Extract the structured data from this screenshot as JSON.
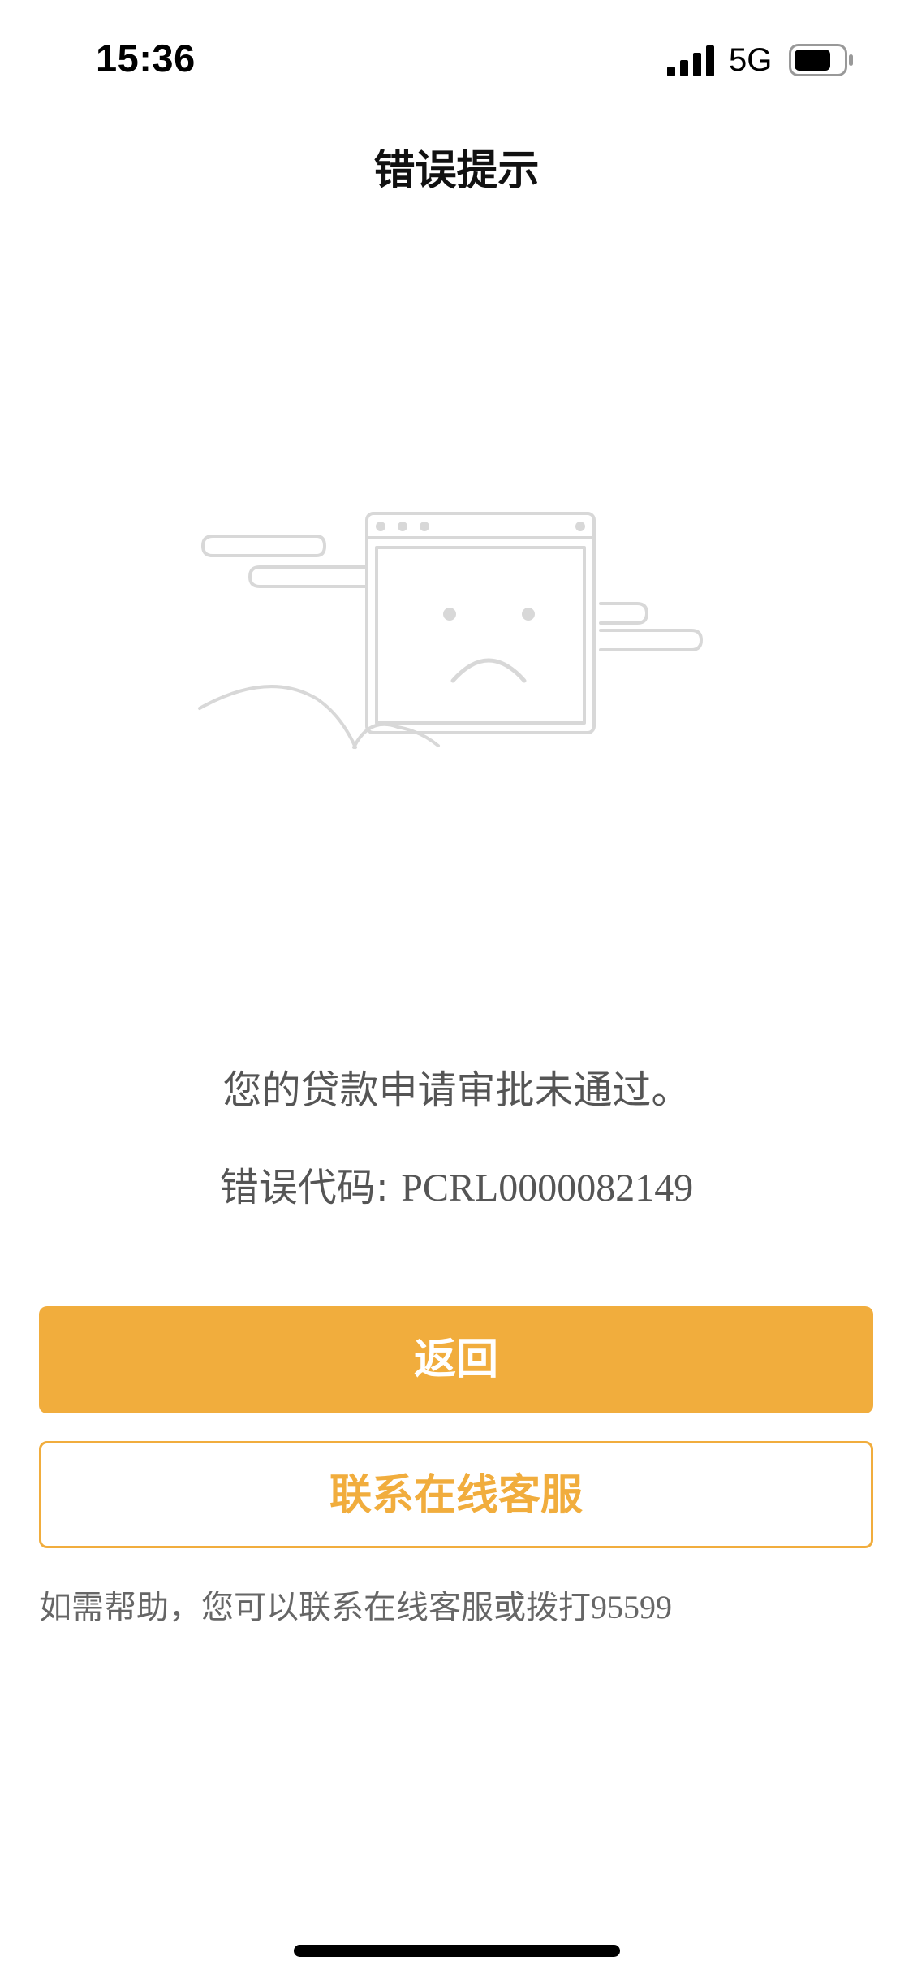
{
  "status_bar": {
    "time": "15:36",
    "network": "5G",
    "icons": [
      "signal-icon",
      "battery-icon"
    ]
  },
  "nav": {
    "title": "错误提示"
  },
  "illustration": {
    "icon": "sad-browser-window-icon"
  },
  "error": {
    "message": "您的贷款申请审批未通过。",
    "code_label": "错误代码: ",
    "code_value": "PCRL0000082149"
  },
  "buttons": {
    "back_label": "返回",
    "service_label": "联系在线客服"
  },
  "help": {
    "text": "如需帮助，您可以联系在线客服或拨打",
    "phone": "95599"
  },
  "colors": {
    "accent": "#f1ad3d",
    "text_secondary": "#555555"
  }
}
